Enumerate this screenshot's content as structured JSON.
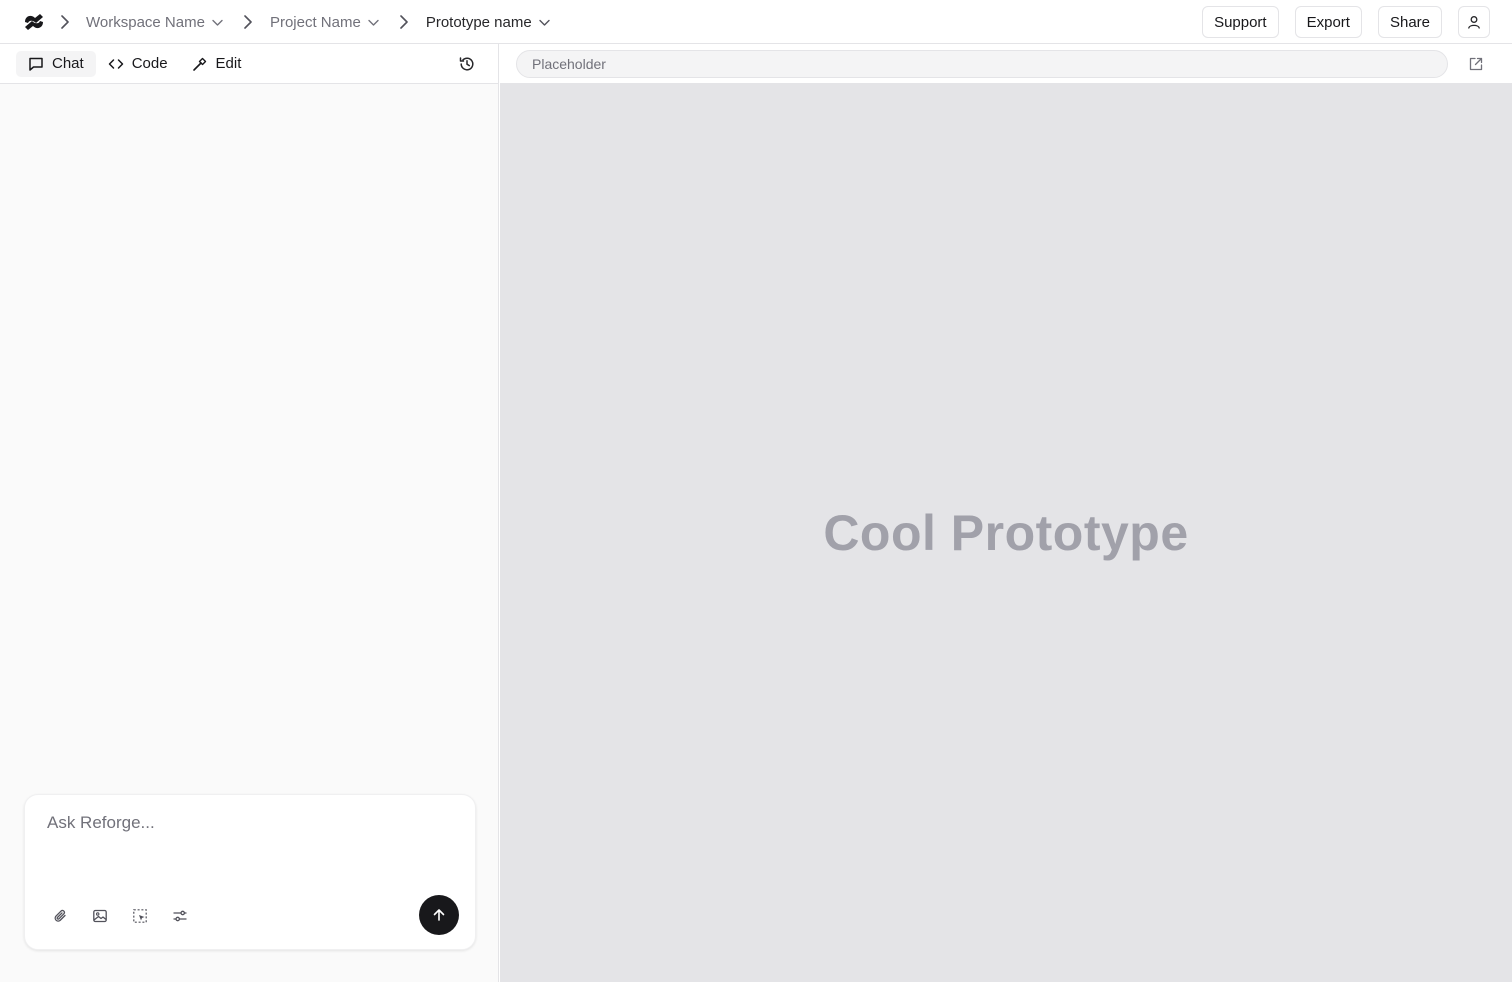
{
  "breadcrumb": {
    "workspace": "Workspace Name",
    "project": "Project Name",
    "prototype": "Prototype name"
  },
  "header": {
    "support_label": "Support",
    "export_label": "Export",
    "share_label": "Share"
  },
  "left_tabs": [
    {
      "label": "Chat",
      "icon": "chat-bubble-icon",
      "active": true
    },
    {
      "label": "Code",
      "icon": "code-brackets-icon",
      "active": false
    },
    {
      "label": "Edit",
      "icon": "hammer-icon",
      "active": false
    }
  ],
  "composer": {
    "placeholder": "Ask Reforge...",
    "tools": [
      "paperclip-icon",
      "image-icon",
      "select-element-icon",
      "settings-sliders-icon"
    ],
    "send_icon": "arrow-up-icon"
  },
  "preview": {
    "url_placeholder": "Placeholder",
    "title": "Cool Prototype"
  },
  "colors": {
    "panel_bg": "#fafafa",
    "preview_bg": "#e4e4e7",
    "border": "#e4e4e7",
    "send_button": "#18181b",
    "preview_title": "#a1a1aa"
  }
}
